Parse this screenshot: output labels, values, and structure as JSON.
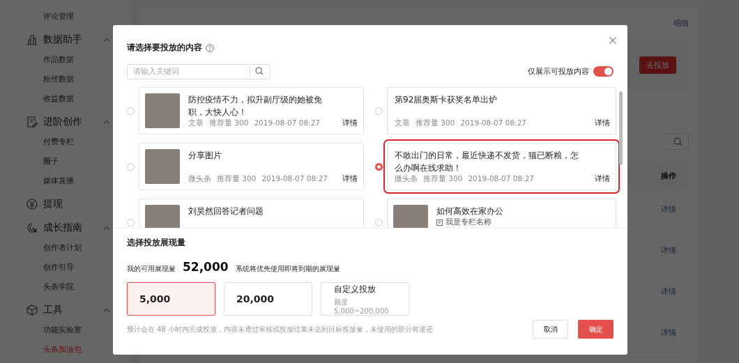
{
  "sidebar": {
    "items": [
      {
        "label": "评论管理",
        "kind": "sub",
        "selected": false
      },
      {
        "label": "数据助手",
        "kind": "group",
        "expanded": true
      },
      {
        "label": "作品数据",
        "kind": "sub",
        "selected": false
      },
      {
        "label": "粉丝数据",
        "kind": "sub",
        "selected": false
      },
      {
        "label": "收益数据",
        "kind": "sub",
        "selected": false
      },
      {
        "label": "进阶创作",
        "kind": "group",
        "expanded": true
      },
      {
        "label": "付费专栏",
        "kind": "sub",
        "selected": false
      },
      {
        "label": "圈子",
        "kind": "sub",
        "selected": false
      },
      {
        "label": "媒体直播",
        "kind": "sub",
        "selected": false
      },
      {
        "label": "提现",
        "kind": "group"
      },
      {
        "label": "成长指南",
        "kind": "group",
        "expanded": true
      },
      {
        "label": "创作者计划",
        "kind": "sub",
        "selected": false
      },
      {
        "label": "创作引导",
        "kind": "sub",
        "selected": false
      },
      {
        "label": "头条学院",
        "kind": "sub",
        "selected": false
      },
      {
        "label": "工具",
        "kind": "group",
        "expanded": true
      },
      {
        "label": "功能实验室",
        "kind": "sub",
        "selected": false
      },
      {
        "label": "头条加油包",
        "kind": "sub",
        "selected": true
      }
    ]
  },
  "background": {
    "link": "明细",
    "action_button": "去投放",
    "table_header": "操作",
    "row_links": [
      "详情",
      "详情",
      "详情",
      "详情"
    ]
  },
  "dialog": {
    "title": "请选择要投放的内容",
    "search": {
      "placeholder": "请输入关键词"
    },
    "filter_toggle": {
      "label": "仅展示可投放内容",
      "on": true
    },
    "items": [
      {
        "title": "防控疫情不力，拟升副厅级的她被免职，大快人心！",
        "has_image": true,
        "type": "文章",
        "recommend": "推荐量 300",
        "date": "2019-08-07 08:27",
        "detail": "详情",
        "selected": false
      },
      {
        "title": "第92届奥斯卡获奖名单出炉",
        "has_image": false,
        "type": "文章",
        "recommend": "推荐量 300",
        "date": "2019-08-07 08:27",
        "detail": "详情",
        "selected": false
      },
      {
        "title": "分享图片",
        "has_image": true,
        "type": "微头条",
        "recommend": "推荐量 300",
        "date": "2019-08-07 08:27",
        "detail": "详情",
        "selected": false
      },
      {
        "title": "不敢出门的日常，最近快递不发货，猫已断粮，怎么办啊在线求助！",
        "has_image": false,
        "type": "微头条",
        "recommend": "推荐量 300",
        "date": "2019-08-07 08:27",
        "detail": "详情",
        "selected": true
      },
      {
        "title": "刘昊然回答记者问题",
        "has_image": true,
        "selected": false
      },
      {
        "title": "如何高效在家办公",
        "has_image": true,
        "column": "我是专栏名称",
        "selected": false
      }
    ],
    "amount_section": {
      "title": "选择投放展现量",
      "available_label": "我的可用展现量",
      "available_value": "52,000",
      "note": "系统将优先使用即将到期的展现量",
      "options": [
        {
          "kind": "fixed",
          "label": "5,000",
          "selected": true
        },
        {
          "kind": "fixed",
          "label": "20,000",
          "selected": false
        },
        {
          "kind": "custom",
          "label": "自定义投放",
          "hint": "额度 5,000~200,000",
          "selected": false
        }
      ],
      "footnote": "预计会在 48 小时内完成投放，内容未通过审核或投放结束未达到目标投放量，未使用的部分将退还"
    },
    "buttons": {
      "cancel": "取消",
      "confirm": "确定"
    }
  }
}
